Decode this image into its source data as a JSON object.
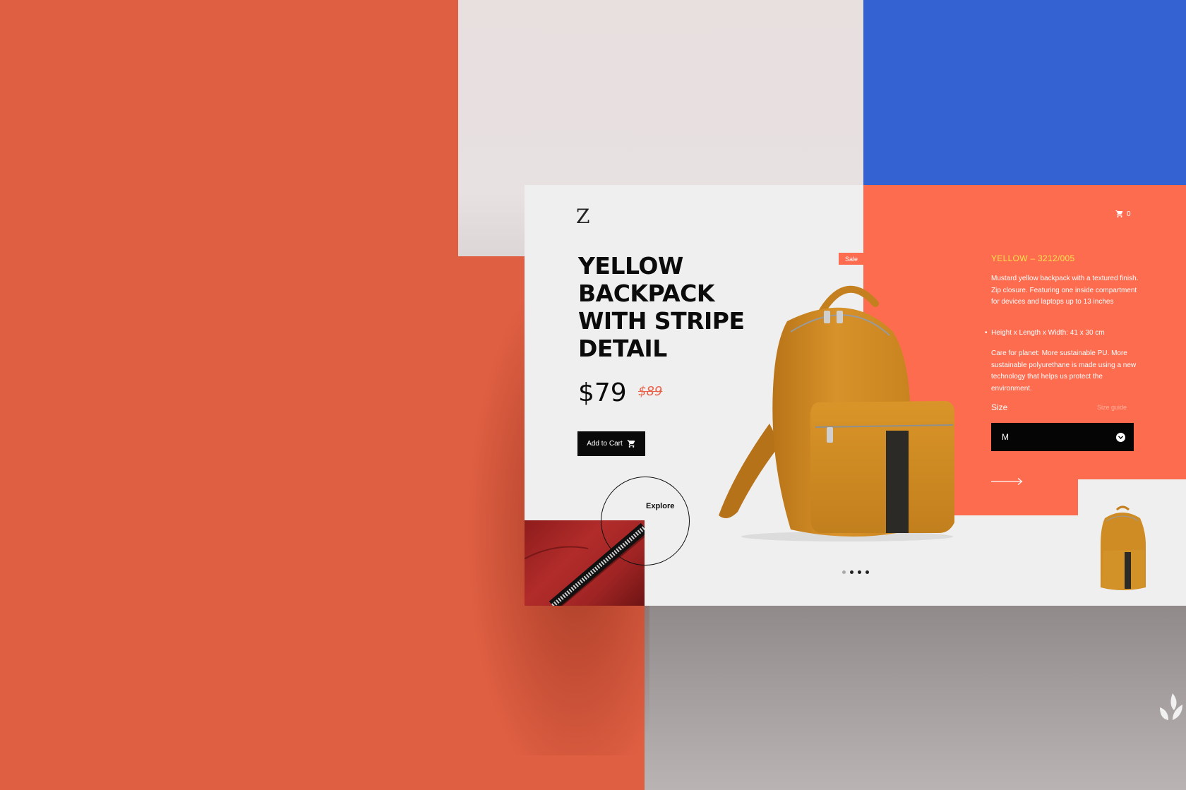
{
  "brand": {
    "logo_letter": "Z"
  },
  "product": {
    "title": "YELLOW BACKPACK WITH STRIPE DETAIL",
    "price": "$79",
    "old_price": "$89",
    "add_to_cart_label": "Add to Cart",
    "sale_badge": "Sale",
    "explore_label": "Explore",
    "sku": "YELLOW – 3212/005",
    "description": "Mustard yellow backpack with a textured finish. Zip closure. Featuring one inside compartment for devices and laptops up to 13 inches",
    "dimensions": "Height x Length x Width: 41 x 30 cm",
    "care": "Care for planet: More sustainable PU. More sustainable polyurethane is made using a new technology that helps us protect the environment.",
    "size_label": "Size",
    "size_guide_label": "Size guide",
    "selected_size": "M"
  },
  "cart": {
    "count": "0"
  },
  "carousel": {
    "total": 4,
    "active": 1
  },
  "colors": {
    "accent_orange": "#fe6c4f",
    "background_orange": "#df5f42",
    "blue": "#3562d2",
    "sku_yellow": "#ffe34d",
    "bag_mustard": "#d18a23"
  },
  "icons": [
    "logo-z-icon",
    "cart-icon",
    "chevron-down-icon",
    "arrow-right-icon",
    "leaf-icon"
  ]
}
